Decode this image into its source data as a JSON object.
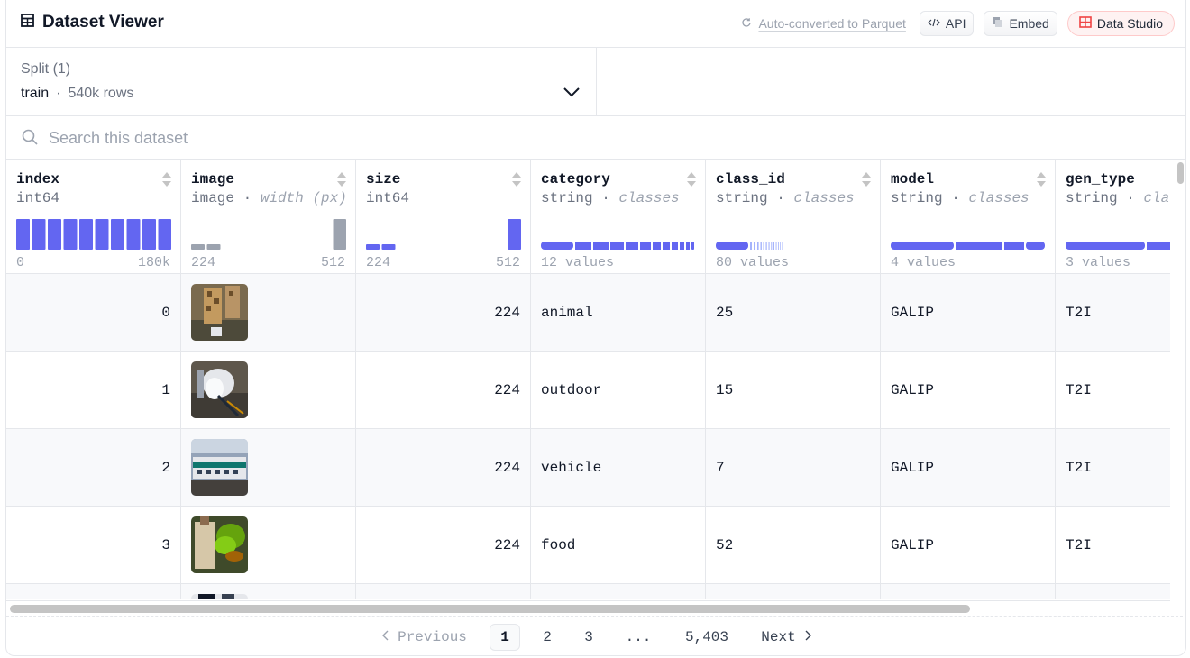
{
  "header": {
    "title": "Dataset Viewer",
    "parquet_label": "Auto-converted to Parquet",
    "api_label": "API",
    "embed_label": "Embed",
    "studio_label": "Data Studio"
  },
  "split": {
    "label": "Split (1)",
    "name": "train",
    "separator": "·",
    "rows": "540k rows"
  },
  "search": {
    "placeholder": "Search this dataset"
  },
  "columns": [
    {
      "name": "index",
      "type": "int64",
      "hint": "",
      "range_min": "0",
      "range_max": "180k",
      "summary": ""
    },
    {
      "name": "image",
      "type": "image",
      "hint": "width (px)",
      "range_min": "224",
      "range_max": "512",
      "summary": ""
    },
    {
      "name": "size",
      "type": "int64",
      "hint": "",
      "range_min": "224",
      "range_max": "512",
      "summary": ""
    },
    {
      "name": "category",
      "type": "string",
      "hint": "classes",
      "range_min": "",
      "range_max": "",
      "summary": "12 values"
    },
    {
      "name": "class_id",
      "type": "string",
      "hint": "classes",
      "range_min": "",
      "range_max": "",
      "summary": "80 values"
    },
    {
      "name": "model",
      "type": "string",
      "hint": "classes",
      "range_min": "",
      "range_max": "",
      "summary": "4 values"
    },
    {
      "name": "gen_type",
      "type": "string",
      "hint": "classes",
      "range_min": "",
      "range_max": "",
      "summary": "3 values"
    }
  ],
  "type_separator": "·",
  "rows": [
    {
      "index": "0",
      "image": "giraffe photo",
      "size": "224",
      "category": "animal",
      "class_id": "25",
      "model": "GALIP",
      "gen_type": "T2I"
    },
    {
      "index": "1",
      "image": "umbrella photo",
      "size": "224",
      "category": "outdoor",
      "class_id": "15",
      "model": "GALIP",
      "gen_type": "T2I"
    },
    {
      "index": "2",
      "image": "train photo",
      "size": "224",
      "category": "vehicle",
      "class_id": "7",
      "model": "GALIP",
      "gen_type": "T2I"
    },
    {
      "index": "3",
      "image": "vegetables photo",
      "size": "224",
      "category": "food",
      "class_id": "52",
      "model": "GALIP",
      "gen_type": "T2I"
    }
  ],
  "pagination": {
    "previous": "Previous",
    "pages": [
      "1",
      "2",
      "3",
      "...",
      "5,403"
    ],
    "current": "1",
    "next": "Next"
  },
  "colors": {
    "accent": "#6366f1",
    "histogram_gray": "#9ca3af",
    "border": "#e5e7eb",
    "studio_bg": "#fef2f2"
  },
  "icons": {
    "title": "table-icon",
    "parquet": "refresh-icon",
    "api": "code-icon",
    "embed": "embed-icon",
    "studio": "grid-icon",
    "split": "chevron-down-icon",
    "search": "search-icon"
  }
}
